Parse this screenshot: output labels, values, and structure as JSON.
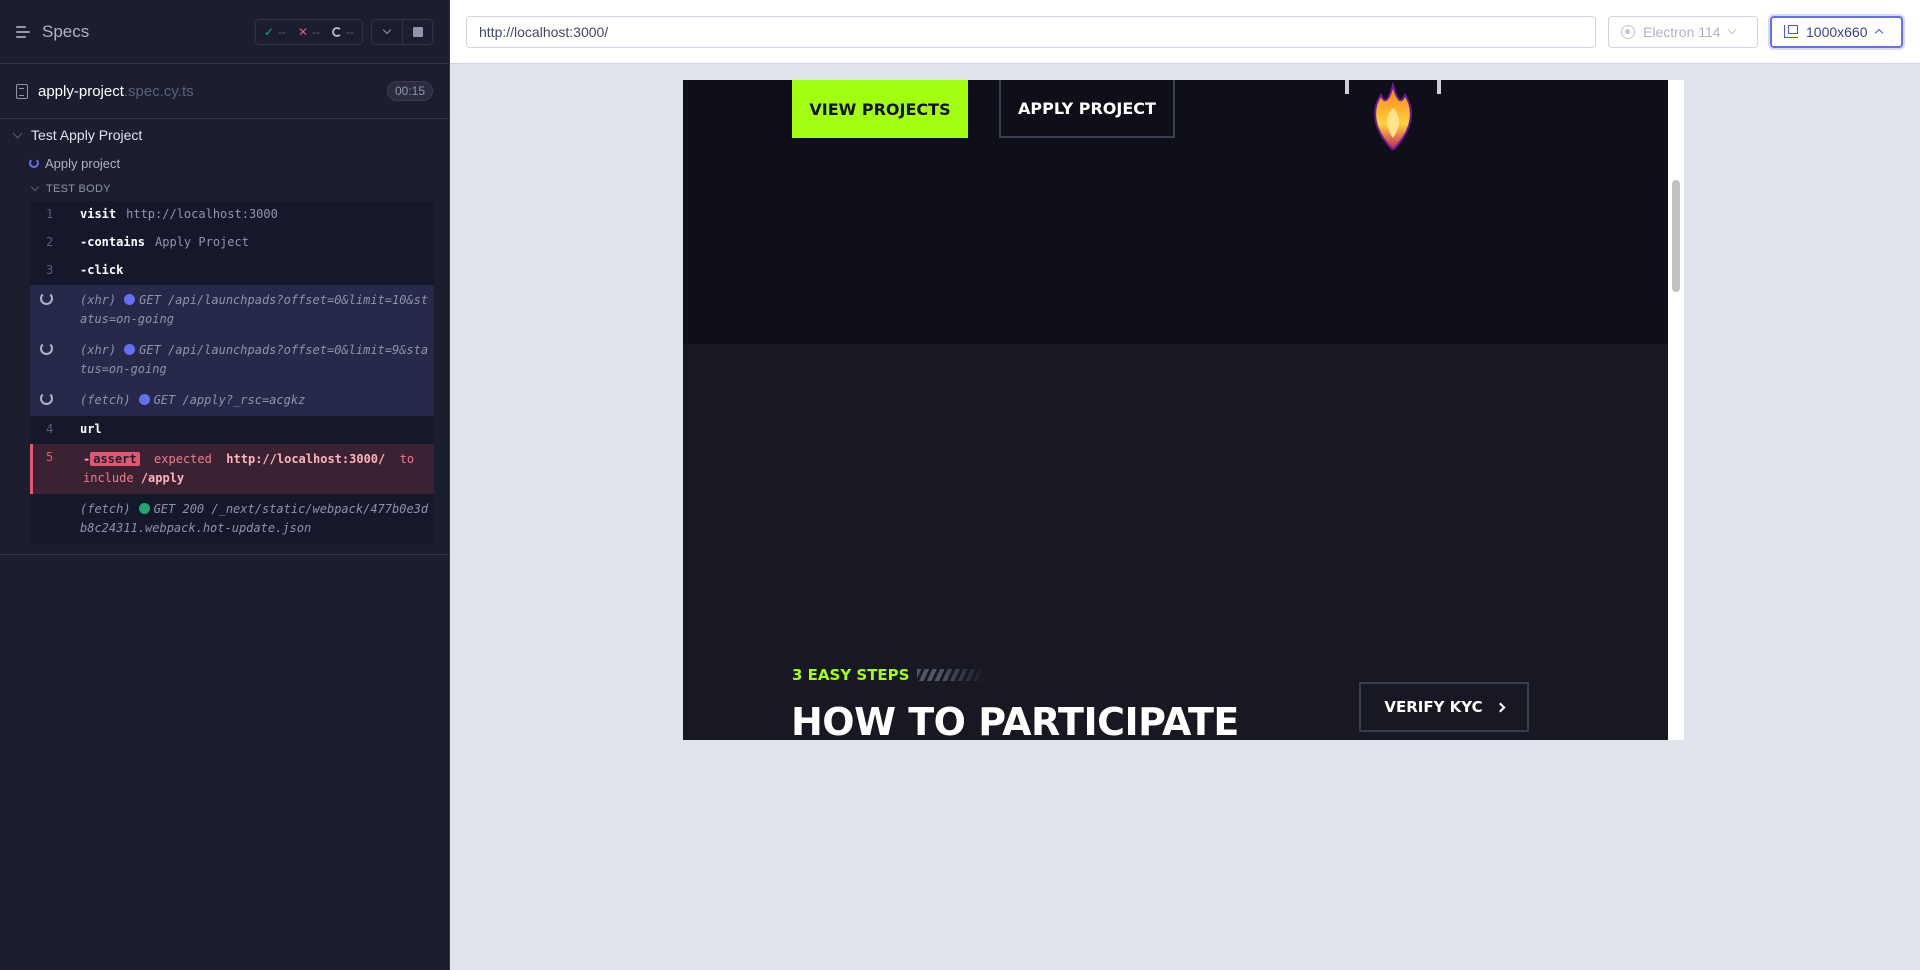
{
  "reporter": {
    "title": "Specs",
    "stats": {
      "passed": "--",
      "failed": "--",
      "pending": "--"
    },
    "spec": {
      "name": "apply-project",
      "ext": ".spec.cy.ts",
      "duration": "00:15"
    },
    "suite": "Test Apply Project",
    "test": "Apply project",
    "body_label": "TEST BODY",
    "commands": [
      {
        "num": "1",
        "name": "visit",
        "msg": "http://localhost:3000"
      },
      {
        "num": "2",
        "name": "-contains",
        "msg": "Apply Project"
      },
      {
        "num": "3",
        "name": "-click",
        "msg": ""
      }
    ],
    "requests": [
      {
        "type": "(xhr)",
        "text": "GET /api/launchpads?offset=0&limit=10&status=on-going"
      },
      {
        "type": "(xhr)",
        "text": "GET /api/launchpads?offset=0&limit=9&status=on-going"
      },
      {
        "type": "(fetch)",
        "text": "GET /apply?_rsc=acgkz"
      }
    ],
    "url_cmd": {
      "num": "4",
      "name": "url"
    },
    "assert_cmd": {
      "num": "5",
      "prefix": "-",
      "badge": "assert",
      "expected": "expected",
      "url": "http://localhost:3000/",
      "to": "to",
      "include": "include",
      "value": "/apply"
    },
    "hot_update": {
      "type": "(fetch)",
      "text": "GET 200 /_next/static/webpack/477b0e3db8c24311.webpack.hot-update.json"
    }
  },
  "aut": {
    "url": "http://localhost:3000/",
    "browser": "Electron 114",
    "viewport": "1000x660",
    "app": {
      "view_projects": "VIEW PROJECTS",
      "apply_project": "APPLY PROJECT",
      "steps_label": "3 EASY STEPS",
      "how_title": "HOW TO PARTICIPATE",
      "verify_kyc": "VERIFY KYC"
    },
    "colors": {
      "accent": "#a3ff12",
      "fail": "#e45770",
      "running": "#6470f3"
    }
  }
}
